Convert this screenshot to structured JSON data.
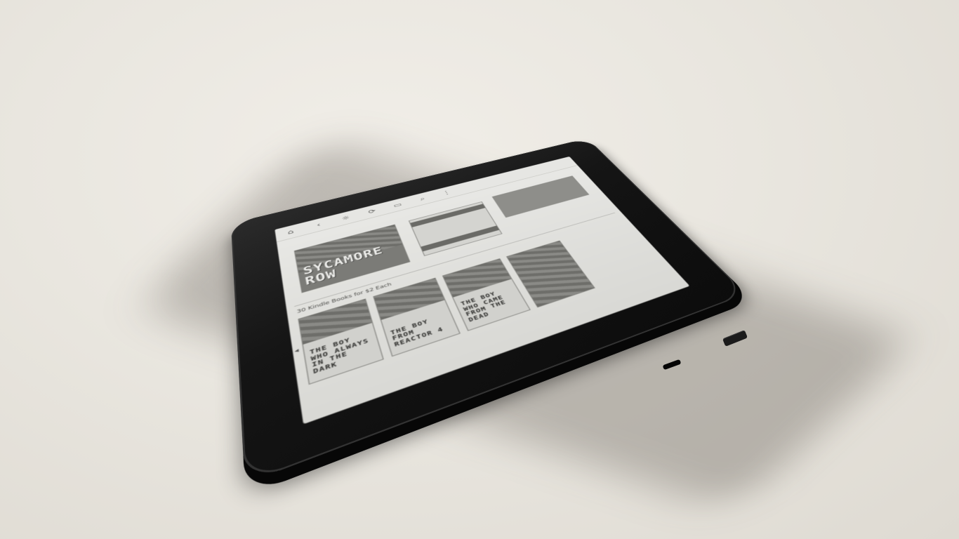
{
  "scene": {
    "background_color": "#e9e6df",
    "device_color": "#151515",
    "screen_color": "#dcdcd8"
  },
  "screen": {
    "topbar_icons": [
      "home-icon",
      "back-icon",
      "light-icon",
      "sync-icon",
      "store-icon",
      "search-icon",
      "menu-icon"
    ],
    "top_books": [
      {
        "title": "SYCAMORE ROW"
      }
    ],
    "section_title": "30 Kindle Books for $2 Each",
    "row_books": [
      {
        "title": "THE BOY WHO ALWAYS IN THE DARK"
      },
      {
        "title": "THE BOY FROM REACTOR 4"
      },
      {
        "title": "THE BOY WHO CAME FROM THE DEAD"
      },
      {
        "title": ""
      }
    ]
  }
}
